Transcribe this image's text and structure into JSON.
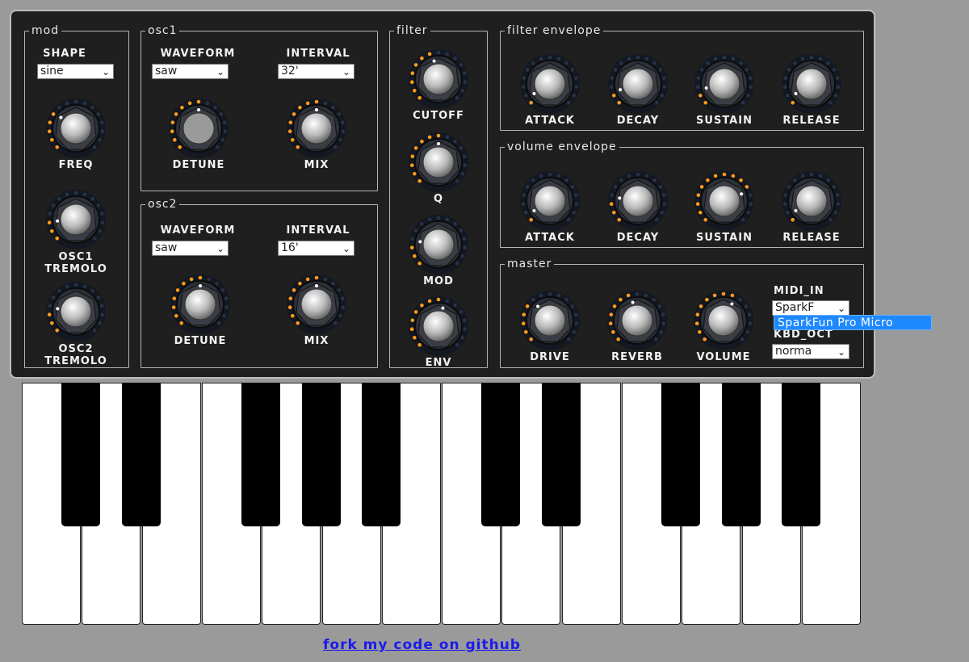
{
  "panels": {
    "mod": {
      "legend": "MOD",
      "shape_label": "SHAPE",
      "shape_value": "sine",
      "knobs": [
        {
          "label": "FREQ",
          "value": 0.3
        },
        {
          "label1": "OSC1",
          "label2": "TREMOLO",
          "value": 0.15
        },
        {
          "label1": "OSC2",
          "label2": "TREMOLO",
          "value": 0.2
        }
      ]
    },
    "osc1": {
      "legend": "OSC1",
      "waveform_label": "WAVEFORM",
      "waveform_value": "saw",
      "interval_label": "INTERVAL",
      "interval_value": "32'",
      "detune": {
        "label": "DETUNE",
        "value": 0.5
      },
      "mix": {
        "label": "MIX",
        "value": 0.5
      }
    },
    "osc2": {
      "legend": "OSC2",
      "waveform_label": "WAVEFORM",
      "waveform_value": "saw",
      "interval_label": "INTERVAL",
      "interval_value": "16'",
      "detune": {
        "label": "DETUNE",
        "value": 0.5
      },
      "mix": {
        "label": "MIX",
        "value": 0.5
      }
    },
    "filter": {
      "legend": "FILTER",
      "knobs": [
        {
          "label": "CUTOFF",
          "value": 0.45
        },
        {
          "label": "Q",
          "value": 0.5
        },
        {
          "label": "MOD",
          "value": 0.2
        },
        {
          "label": "ENV",
          "value": 0.55
        }
      ]
    },
    "filter_envelope": {
      "legend": "FILTER ENVELOPE",
      "knobs": [
        {
          "label": "ATTACK",
          "value": 0.05
        },
        {
          "label": "DECAY",
          "value": 0.1
        },
        {
          "label": "SUSTAIN",
          "value": 0.12
        },
        {
          "label": "RELEASE",
          "value": 0.05
        }
      ]
    },
    "volume_envelope": {
      "legend": "VOLUME ENVELOPE",
      "knobs": [
        {
          "label": "ATTACK",
          "value": 0.05
        },
        {
          "label": "DECAY",
          "value": 0.2
        },
        {
          "label": "SUSTAIN",
          "value": 0.75
        },
        {
          "label": "RELEASE",
          "value": 0.05
        }
      ]
    },
    "master": {
      "legend": "MASTER",
      "knobs": [
        {
          "label": "DRIVE",
          "value": 0.35
        },
        {
          "label": "REVERB",
          "value": 0.45
        },
        {
          "label": "VOLUME",
          "value": 0.6
        }
      ],
      "midi_in_label": "MIDI_IN",
      "midi_in_value": "SparkF",
      "midi_in_highlighted_option": "SparkFun Pro Micro",
      "kbd_oct_label": "KBD_OCT",
      "kbd_oct_value": "norma"
    }
  },
  "footer_link": "Fork my code on GITHUB",
  "colors": {
    "led_on": "#ff9a1a",
    "panel_bg": "#1f1f1f",
    "page_bg": "#9a9a9a",
    "selection_blue": "#1e88ff"
  }
}
